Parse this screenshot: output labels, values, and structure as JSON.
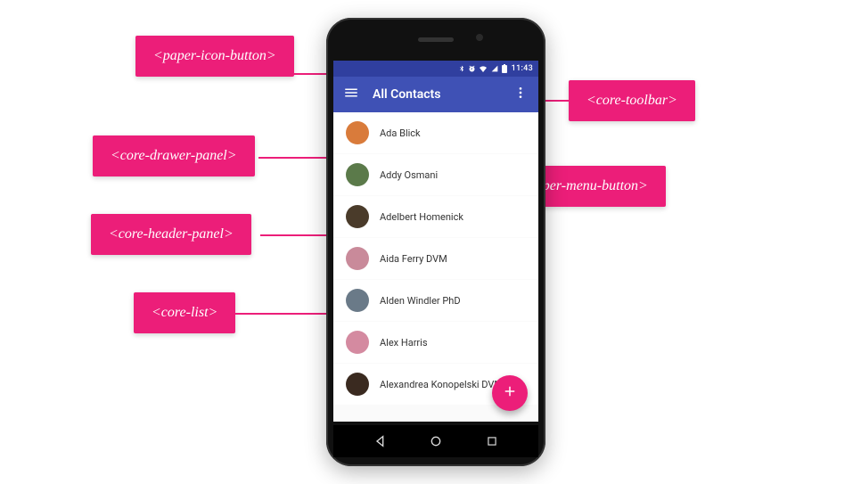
{
  "statusbar": {
    "time": "11:43"
  },
  "toolbar": {
    "title": "All Contacts"
  },
  "contacts": [
    {
      "name": "Ada Blick"
    },
    {
      "name": "Addy Osmani"
    },
    {
      "name": "Adelbert Homenick"
    },
    {
      "name": "Aida Ferry DVM"
    },
    {
      "name": "Alden Windler PhD"
    },
    {
      "name": "Alex Harris"
    },
    {
      "name": "Alexandrea Konopelski DVM"
    }
  ],
  "fab": {
    "glyph": "+"
  },
  "callouts": {
    "paper_icon_button": "<paper-icon-button>",
    "core_toolbar": "<core-toolbar>",
    "core_drawer_panel": "<core-drawer-panel>",
    "paper_menu_button": "<paper-menu-button>",
    "core_header_panel": "<core-header-panel>",
    "core_list": "<core-list>"
  },
  "avatar_colors": [
    "#d97b3b",
    "#5b7a4a",
    "#4a3b2a",
    "#c98a9a",
    "#6a7a88",
    "#d48aa0",
    "#3a2a20"
  ]
}
